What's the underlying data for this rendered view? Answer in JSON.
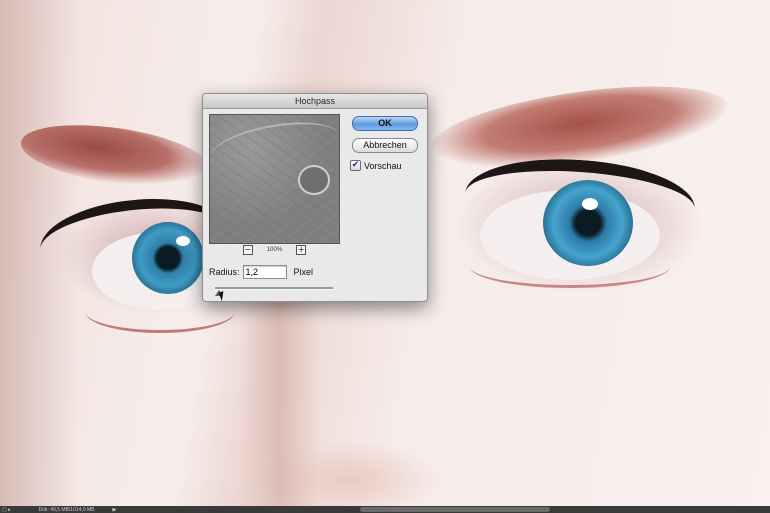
{
  "dialog": {
    "title": "Hochpass",
    "ok_label": "OK",
    "cancel_label": "Abbrechen",
    "preview_label": "Vorschau",
    "preview_checked": true,
    "zoom_out_symbol": "−",
    "zoom_level": "100%",
    "zoom_in_symbol": "+",
    "radius_label": "Radius:",
    "radius_value": "1,2",
    "unit_label": "Pixel",
    "slider_value_fraction": 0.03
  },
  "statusbar": {
    "doc_info": "Dok: 40,5 MB/1014,0 MB"
  },
  "icons": {
    "checkmark": "check-icon",
    "zoom_out": "zoom-out-icon",
    "zoom_in": "zoom-in-icon"
  }
}
